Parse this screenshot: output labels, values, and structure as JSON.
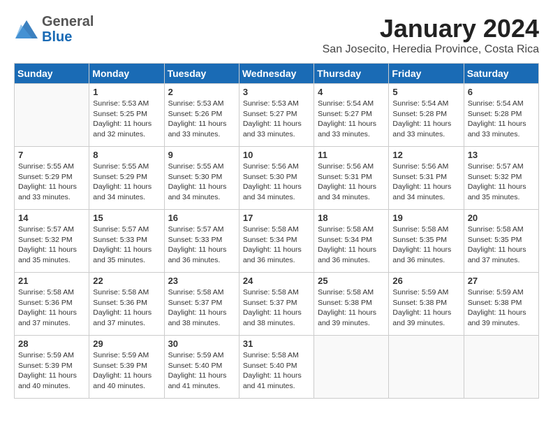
{
  "logo": {
    "general": "General",
    "blue": "Blue"
  },
  "title": "January 2024",
  "location": "San Josecito, Heredia Province, Costa Rica",
  "headers": [
    "Sunday",
    "Monday",
    "Tuesday",
    "Wednesday",
    "Thursday",
    "Friday",
    "Saturday"
  ],
  "weeks": [
    [
      {
        "day": "",
        "info": ""
      },
      {
        "day": "1",
        "info": "Sunrise: 5:53 AM\nSunset: 5:25 PM\nDaylight: 11 hours\nand 32 minutes."
      },
      {
        "day": "2",
        "info": "Sunrise: 5:53 AM\nSunset: 5:26 PM\nDaylight: 11 hours\nand 33 minutes."
      },
      {
        "day": "3",
        "info": "Sunrise: 5:53 AM\nSunset: 5:27 PM\nDaylight: 11 hours\nand 33 minutes."
      },
      {
        "day": "4",
        "info": "Sunrise: 5:54 AM\nSunset: 5:27 PM\nDaylight: 11 hours\nand 33 minutes."
      },
      {
        "day": "5",
        "info": "Sunrise: 5:54 AM\nSunset: 5:28 PM\nDaylight: 11 hours\nand 33 minutes."
      },
      {
        "day": "6",
        "info": "Sunrise: 5:54 AM\nSunset: 5:28 PM\nDaylight: 11 hours\nand 33 minutes."
      }
    ],
    [
      {
        "day": "7",
        "info": "Sunrise: 5:55 AM\nSunset: 5:29 PM\nDaylight: 11 hours\nand 33 minutes."
      },
      {
        "day": "8",
        "info": "Sunrise: 5:55 AM\nSunset: 5:29 PM\nDaylight: 11 hours\nand 34 minutes."
      },
      {
        "day": "9",
        "info": "Sunrise: 5:55 AM\nSunset: 5:30 PM\nDaylight: 11 hours\nand 34 minutes."
      },
      {
        "day": "10",
        "info": "Sunrise: 5:56 AM\nSunset: 5:30 PM\nDaylight: 11 hours\nand 34 minutes."
      },
      {
        "day": "11",
        "info": "Sunrise: 5:56 AM\nSunset: 5:31 PM\nDaylight: 11 hours\nand 34 minutes."
      },
      {
        "day": "12",
        "info": "Sunrise: 5:56 AM\nSunset: 5:31 PM\nDaylight: 11 hours\nand 34 minutes."
      },
      {
        "day": "13",
        "info": "Sunrise: 5:57 AM\nSunset: 5:32 PM\nDaylight: 11 hours\nand 35 minutes."
      }
    ],
    [
      {
        "day": "14",
        "info": "Sunrise: 5:57 AM\nSunset: 5:32 PM\nDaylight: 11 hours\nand 35 minutes."
      },
      {
        "day": "15",
        "info": "Sunrise: 5:57 AM\nSunset: 5:33 PM\nDaylight: 11 hours\nand 35 minutes."
      },
      {
        "day": "16",
        "info": "Sunrise: 5:57 AM\nSunset: 5:33 PM\nDaylight: 11 hours\nand 36 minutes."
      },
      {
        "day": "17",
        "info": "Sunrise: 5:58 AM\nSunset: 5:34 PM\nDaylight: 11 hours\nand 36 minutes."
      },
      {
        "day": "18",
        "info": "Sunrise: 5:58 AM\nSunset: 5:34 PM\nDaylight: 11 hours\nand 36 minutes."
      },
      {
        "day": "19",
        "info": "Sunrise: 5:58 AM\nSunset: 5:35 PM\nDaylight: 11 hours\nand 36 minutes."
      },
      {
        "day": "20",
        "info": "Sunrise: 5:58 AM\nSunset: 5:35 PM\nDaylight: 11 hours\nand 37 minutes."
      }
    ],
    [
      {
        "day": "21",
        "info": "Sunrise: 5:58 AM\nSunset: 5:36 PM\nDaylight: 11 hours\nand 37 minutes."
      },
      {
        "day": "22",
        "info": "Sunrise: 5:58 AM\nSunset: 5:36 PM\nDaylight: 11 hours\nand 37 minutes."
      },
      {
        "day": "23",
        "info": "Sunrise: 5:58 AM\nSunset: 5:37 PM\nDaylight: 11 hours\nand 38 minutes."
      },
      {
        "day": "24",
        "info": "Sunrise: 5:58 AM\nSunset: 5:37 PM\nDaylight: 11 hours\nand 38 minutes."
      },
      {
        "day": "25",
        "info": "Sunrise: 5:58 AM\nSunset: 5:38 PM\nDaylight: 11 hours\nand 39 minutes."
      },
      {
        "day": "26",
        "info": "Sunrise: 5:59 AM\nSunset: 5:38 PM\nDaylight: 11 hours\nand 39 minutes."
      },
      {
        "day": "27",
        "info": "Sunrise: 5:59 AM\nSunset: 5:38 PM\nDaylight: 11 hours\nand 39 minutes."
      }
    ],
    [
      {
        "day": "28",
        "info": "Sunrise: 5:59 AM\nSunset: 5:39 PM\nDaylight: 11 hours\nand 40 minutes."
      },
      {
        "day": "29",
        "info": "Sunrise: 5:59 AM\nSunset: 5:39 PM\nDaylight: 11 hours\nand 40 minutes."
      },
      {
        "day": "30",
        "info": "Sunrise: 5:59 AM\nSunset: 5:40 PM\nDaylight: 11 hours\nand 41 minutes."
      },
      {
        "day": "31",
        "info": "Sunrise: 5:58 AM\nSunset: 5:40 PM\nDaylight: 11 hours\nand 41 minutes."
      },
      {
        "day": "",
        "info": ""
      },
      {
        "day": "",
        "info": ""
      },
      {
        "day": "",
        "info": ""
      }
    ]
  ]
}
